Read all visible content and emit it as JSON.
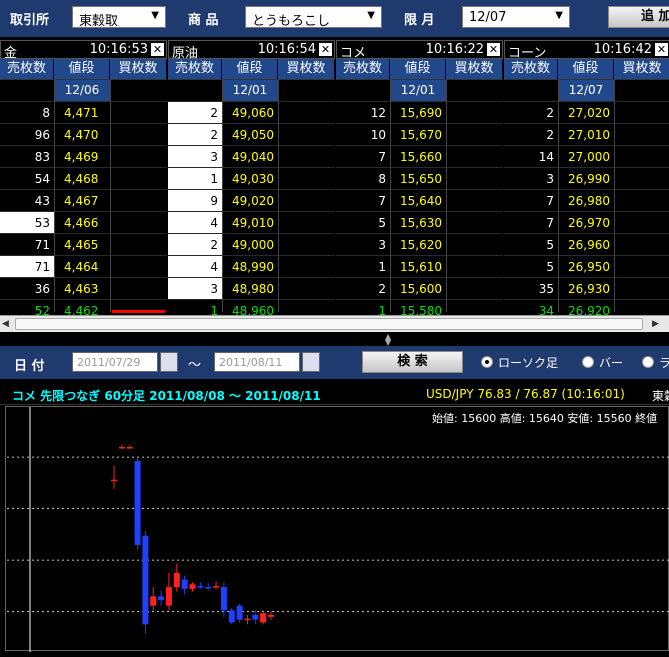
{
  "toolbar": {
    "exchange_label": "取引所",
    "exchange_value": "東穀取",
    "product_label": "商 品",
    "product_value": "とうもろこし",
    "month_label": "限 月",
    "month_value": "12/07",
    "add_label": "追 加"
  },
  "columns": [
    "売枚数",
    "値段",
    "買枚数"
  ],
  "panels": [
    {
      "name": "金",
      "time": "10:16:53",
      "month": "12/06",
      "rows": [
        [
          "8",
          "4,471",
          ""
        ],
        [
          "96",
          "4,470",
          ""
        ],
        [
          "83",
          "4,469",
          ""
        ],
        [
          "54",
          "4,468",
          ""
        ],
        [
          "43",
          "4,467",
          ""
        ],
        [
          "53",
          "4,466",
          ""
        ],
        [
          "71",
          "4,465",
          ""
        ],
        [
          "71",
          "4,464",
          ""
        ],
        [
          "36",
          "4,463",
          ""
        ],
        [
          "52",
          "4,462",
          ""
        ]
      ]
    },
    {
      "name": "原油",
      "time": "10:16:54",
      "month": "12/01",
      "rows": [
        [
          "2",
          "49,060",
          ""
        ],
        [
          "2",
          "49,050",
          ""
        ],
        [
          "3",
          "49,040",
          ""
        ],
        [
          "1",
          "49,030",
          ""
        ],
        [
          "9",
          "49,020",
          ""
        ],
        [
          "4",
          "49,010",
          ""
        ],
        [
          "2",
          "49,000",
          ""
        ],
        [
          "4",
          "48,990",
          ""
        ],
        [
          "3",
          "48,980",
          ""
        ],
        [
          "1",
          "48,960",
          ""
        ]
      ]
    },
    {
      "name": "コメ",
      "time": "10:16:22",
      "month": "12/01",
      "rows": [
        [
          "12",
          "15,690",
          ""
        ],
        [
          "10",
          "15,670",
          ""
        ],
        [
          "7",
          "15,660",
          ""
        ],
        [
          "8",
          "15,650",
          ""
        ],
        [
          "7",
          "15,640",
          ""
        ],
        [
          "5",
          "15,630",
          ""
        ],
        [
          "3",
          "15,620",
          ""
        ],
        [
          "1",
          "15,610",
          ""
        ],
        [
          "2",
          "15,600",
          ""
        ],
        [
          "1",
          "15,580",
          ""
        ]
      ]
    },
    {
      "name": "コーン",
      "time": "10:16:42",
      "month": "12/07",
      "rows": [
        [
          "2",
          "27,020",
          ""
        ],
        [
          "2",
          "27,010",
          ""
        ],
        [
          "14",
          "27,000",
          ""
        ],
        [
          "3",
          "26,990",
          ""
        ],
        [
          "7",
          "26,980",
          ""
        ],
        [
          "7",
          "26,970",
          ""
        ],
        [
          "5",
          "26,960",
          ""
        ],
        [
          "5",
          "26,950",
          ""
        ],
        [
          "35",
          "26,930",
          ""
        ],
        [
          "34",
          "26,920",
          ""
        ]
      ]
    }
  ],
  "search": {
    "date_label": "日 付",
    "from_date": "2011/07/29",
    "tilde": "～",
    "to_date": "2011/08/11",
    "search_label": "検 索",
    "opt_candle": "ローソク足",
    "opt_bar": "バー",
    "opt_line": "ラ"
  },
  "info": {
    "title": "コメ  先限つなぎ  60分足   2011/08/08  ～  2011/08/11",
    "fx": "USD/JPY 76.83 / 76.87 (10:16:01)",
    "fx_tail": "東穀"
  },
  "ohlc_bar": "始値: 15600  高値: 15640  安値: 15560  終値",
  "colors": {
    "header_bg": "#1e3a6e",
    "col_header_bg": "#22488c",
    "price": "#ffff00",
    "last_row": "#00e000",
    "up_candle": "#ff2020",
    "down_candle": "#2040ff"
  },
  "chart_data": {
    "type": "candlestick",
    "candles": [
      {
        "o": 15715,
        "h": 15730,
        "l": 15705,
        "c": 15715
      },
      {
        "o": 15750,
        "h": 15752,
        "l": 15748,
        "c": 15750
      },
      {
        "o": 15750,
        "h": 15752,
        "l": 15748,
        "c": 15750
      },
      {
        "o": 15735,
        "h": 15738,
        "l": 15640,
        "c": 15645
      },
      {
        "o": 15655,
        "h": 15660,
        "l": 15550,
        "c": 15560
      },
      {
        "o": 15580,
        "h": 15600,
        "l": 15575,
        "c": 15590
      },
      {
        "o": 15590,
        "h": 15596,
        "l": 15580,
        "c": 15586
      },
      {
        "o": 15580,
        "h": 15615,
        "l": 15575,
        "c": 15600
      },
      {
        "o": 15600,
        "h": 15625,
        "l": 15595,
        "c": 15615
      },
      {
        "o": 15608,
        "h": 15612,
        "l": 15592,
        "c": 15598
      },
      {
        "o": 15598,
        "h": 15605,
        "l": 15595,
        "c": 15603
      },
      {
        "o": 15601,
        "h": 15605,
        "l": 15598,
        "c": 15600
      },
      {
        "o": 15600,
        "h": 15604,
        "l": 15597,
        "c": 15599
      },
      {
        "o": 15600,
        "h": 15606,
        "l": 15598,
        "c": 15601
      },
      {
        "o": 15600,
        "h": 15605,
        "l": 15568,
        "c": 15575
      },
      {
        "o": 15575,
        "h": 15578,
        "l": 15560,
        "c": 15562
      },
      {
        "o": 15580,
        "h": 15582,
        "l": 15562,
        "c": 15565
      },
      {
        "o": 15565,
        "h": 15570,
        "l": 15560,
        "c": 15566
      },
      {
        "o": 15570,
        "h": 15575,
        "l": 15560,
        "c": 15565
      },
      {
        "o": 15562,
        "h": 15575,
        "l": 15560,
        "c": 15572
      },
      {
        "o": 15568,
        "h": 15574,
        "l": 15565,
        "c": 15570
      }
    ],
    "ylim": [
      15540,
      15780
    ],
    "grid": true
  }
}
